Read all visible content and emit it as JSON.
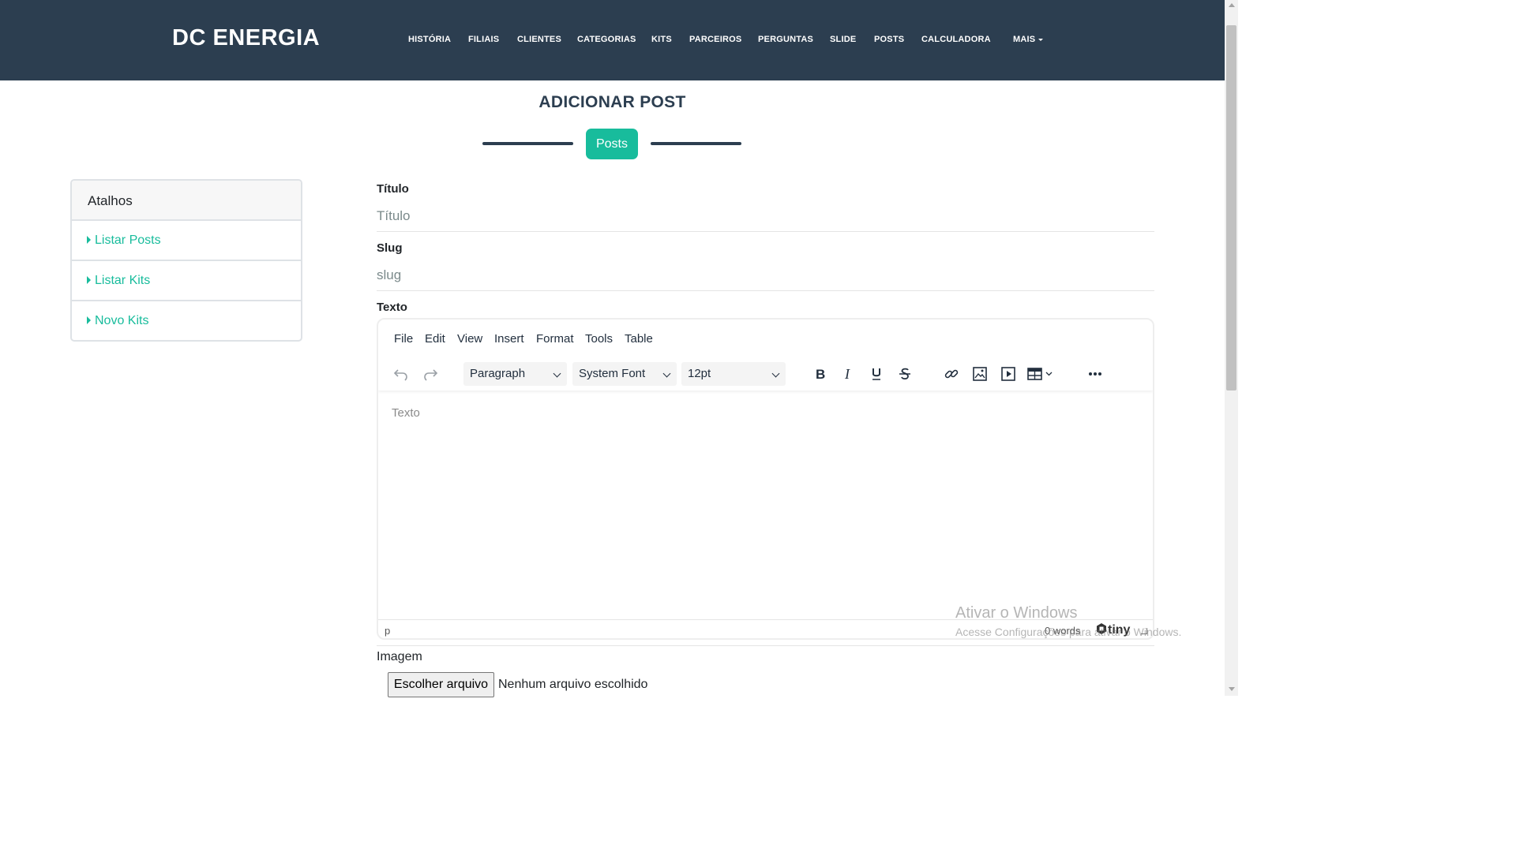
{
  "header": {
    "brand": "DC ENERGIA",
    "nav": [
      "HISTÓRIA",
      "FILIAIS",
      "CLIENTES",
      "CATEGORIAS",
      "KITS",
      "PARCEIROS",
      "PERGUNTAS",
      "SLIDE",
      "POSTS",
      "CALCULADORA",
      "MAIS"
    ]
  },
  "page": {
    "title": "ADICIONAR POST",
    "badge": "Posts"
  },
  "sidebar": {
    "title": "Atalhos",
    "items": [
      "Listar Posts",
      "Listar Kits",
      "Novo Kits"
    ]
  },
  "form": {
    "titulo_label": "Título",
    "titulo_placeholder": "Título",
    "slug_label": "Slug",
    "slug_placeholder": "slug",
    "texto_label": "Texto",
    "imagem_label": "Imagem",
    "file_button": "Escolher arquivo",
    "file_status": "Nenhum arquivo escolhido"
  },
  "editor": {
    "menu": [
      "File",
      "Edit",
      "View",
      "Insert",
      "Format",
      "Tools",
      "Table"
    ],
    "block_format": "Paragraph",
    "font_family": "System Font",
    "font_size": "12pt",
    "placeholder": "Texto",
    "path": "p",
    "word_count": "0 words",
    "logo": "tiny"
  },
  "watermark": {
    "title": "Ativar o Windows",
    "subtitle": "Acesse Configurações para ativar o Windows."
  },
  "colors": {
    "header_bg": "#2c3e50",
    "accent": "#18bc9c"
  }
}
